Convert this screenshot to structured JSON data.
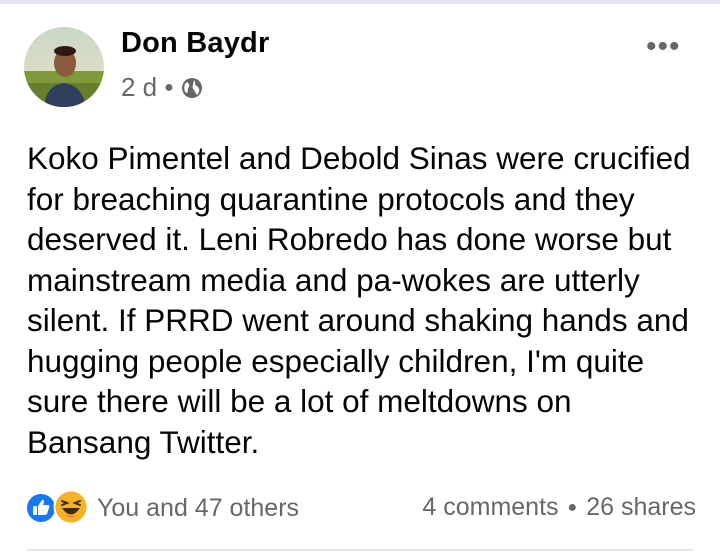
{
  "post": {
    "author": "Don Baydr",
    "time": "2 d",
    "privacy_icon": "globe-icon",
    "more_icon": "more-options-icon",
    "text": "Koko Pimentel and Debold Sinas were crucified\nfor breaching quarantine protocols and they\ndeserved it. Leni Robredo has done worse but\nmainstream media and pa-wokes are utterly\nsilent. If PRRD went around shaking hands and\nhugging people especially children, I'm quite\nsure there will be a lot of meltdowns on\nBansang Twitter.",
    "reactions_text": "You and 47 others",
    "comments": "4 comments",
    "shares": "26 shares"
  },
  "colors": {
    "text": "#050505",
    "secondary": "#65676b",
    "like_blue": "#1877f2",
    "haha_yellow": "#f7b125"
  }
}
